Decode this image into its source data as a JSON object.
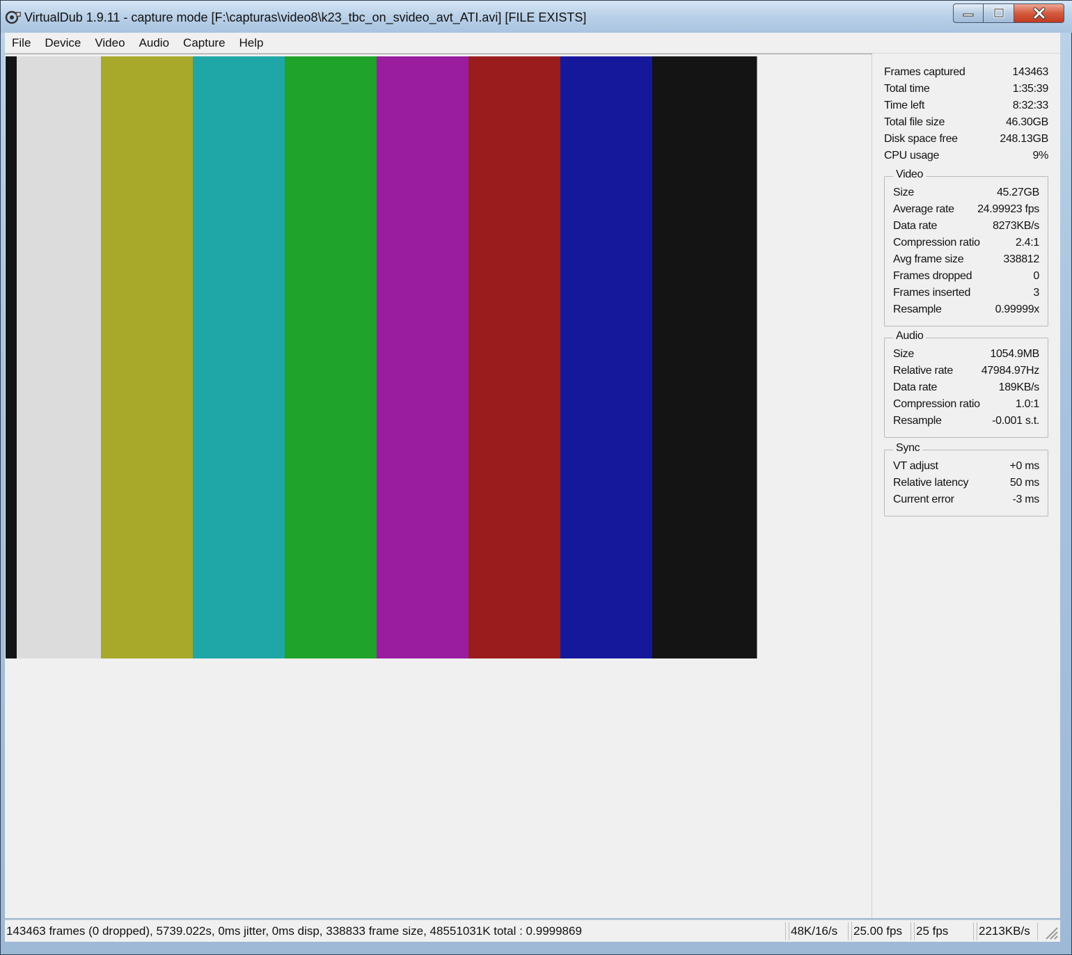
{
  "window": {
    "title": "VirtualDub 1.9.11 - capture mode [F:\\capturas\\video8\\k23_tbc_on_svideo_avt_ATI.avi] [FILE EXISTS]"
  },
  "menu": [
    "File",
    "Device",
    "Video",
    "Audio",
    "Capture",
    "Help"
  ],
  "colors": {
    "bars": [
      "#dcdcdc",
      "#a8a92a",
      "#1fa6a6",
      "#1fa32a",
      "#9b1d9f",
      "#9b1c1c",
      "#16189c",
      "#141414"
    ]
  },
  "stats": {
    "general": [
      {
        "label": "Frames captured",
        "value": "143463"
      },
      {
        "label": "Total time",
        "value": "1:35:39"
      },
      {
        "label": "Time left",
        "value": "8:32:33"
      },
      {
        "label": "Total file size",
        "value": "46.30GB"
      },
      {
        "label": "Disk space free",
        "value": "248.13GB"
      },
      {
        "label": "CPU usage",
        "value": "9%"
      }
    ],
    "video": {
      "title": "Video",
      "rows": [
        {
          "label": "Size",
          "value": "45.27GB"
        },
        {
          "label": "Average rate",
          "value": "24.99923 fps"
        },
        {
          "label": "Data rate",
          "value": "8273KB/s"
        },
        {
          "label": "Compression ratio",
          "value": "2.4:1"
        },
        {
          "label": "Avg frame size",
          "value": "338812"
        },
        {
          "label": "Frames dropped",
          "value": "0"
        },
        {
          "label": "Frames inserted",
          "value": "3"
        },
        {
          "label": "Resample",
          "value": "0.99999x"
        }
      ]
    },
    "audio": {
      "title": "Audio",
      "rows": [
        {
          "label": "Size",
          "value": "1054.9MB"
        },
        {
          "label": "Relative rate",
          "value": "47984.97Hz"
        },
        {
          "label": "Data rate",
          "value": "189KB/s"
        },
        {
          "label": "Compression ratio",
          "value": "1.0:1"
        },
        {
          "label": "Resample",
          "value": "-0.001 s.t."
        }
      ]
    },
    "sync": {
      "title": "Sync",
      "rows": [
        {
          "label": "VT adjust",
          "value": "+0 ms"
        },
        {
          "label": "Relative latency",
          "value": "50 ms"
        },
        {
          "label": "Current error",
          "value": "-3 ms"
        }
      ]
    }
  },
  "statusbar": {
    "main": "143463 frames (0 dropped), 5739.022s, 0ms jitter, 0ms disp, 338833 frame size, 48551031K total : 0.9999869",
    "audio_format": "48K/16/s",
    "actual_fps": "25.00 fps",
    "target_fps": "25 fps",
    "data_rate": "2213KB/s"
  }
}
